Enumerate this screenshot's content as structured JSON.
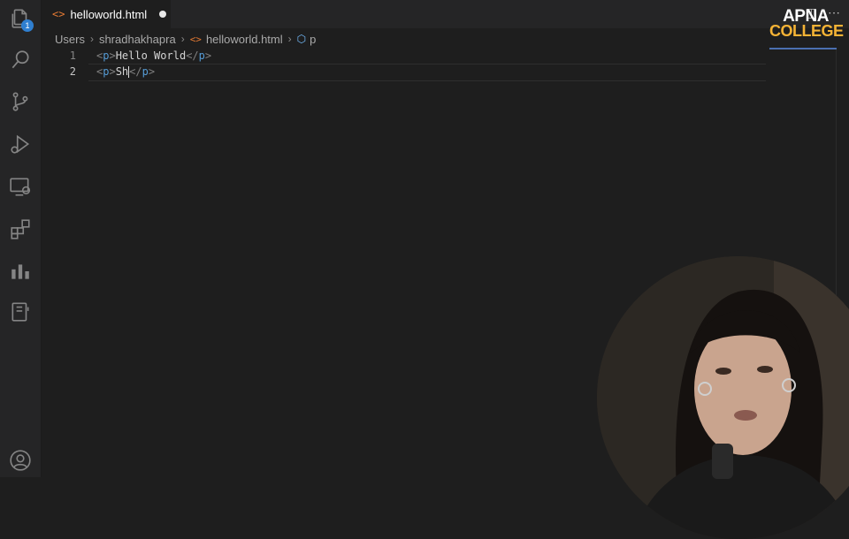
{
  "activity_bar": {
    "items": [
      {
        "name": "explorer",
        "icon": "files-icon",
        "badge": "1"
      },
      {
        "name": "search",
        "icon": "search-icon"
      },
      {
        "name": "source-control",
        "icon": "source-control-icon"
      },
      {
        "name": "run-debug",
        "icon": "run-debug-icon"
      },
      {
        "name": "remote-explorer",
        "icon": "remote-explorer-icon"
      },
      {
        "name": "extensions",
        "icon": "extensions-icon"
      },
      {
        "name": "stats",
        "icon": "bar-chart-icon"
      },
      {
        "name": "notebook",
        "icon": "notebook-icon"
      }
    ],
    "account_icon": "account-icon"
  },
  "tab": {
    "label": "helloworld.html",
    "unsaved": true
  },
  "breadcrumb": {
    "items": [
      "Users",
      "shradhakhapra",
      "helloworld.html",
      "p"
    ]
  },
  "editor": {
    "lines": [
      {
        "number": "1",
        "open_bracket": "<",
        "open_tag": "p",
        "open_close": ">",
        "text": "Hello World",
        "close_bracket": "</",
        "close_tag": "p",
        "close_end": ">"
      },
      {
        "number": "2",
        "open_bracket": "<",
        "open_tag": "p",
        "open_close": ">",
        "text": "Sh",
        "close_bracket": "</",
        "close_tag": "p",
        "close_end": ">"
      }
    ]
  },
  "logo": {
    "line1": "APNA",
    "line2": "COLLEGE"
  },
  "colors": {
    "accent": "#2f7fd0",
    "html_icon": "#e37933",
    "tag": "#569cd6",
    "logo_gold": "#f5b335"
  }
}
